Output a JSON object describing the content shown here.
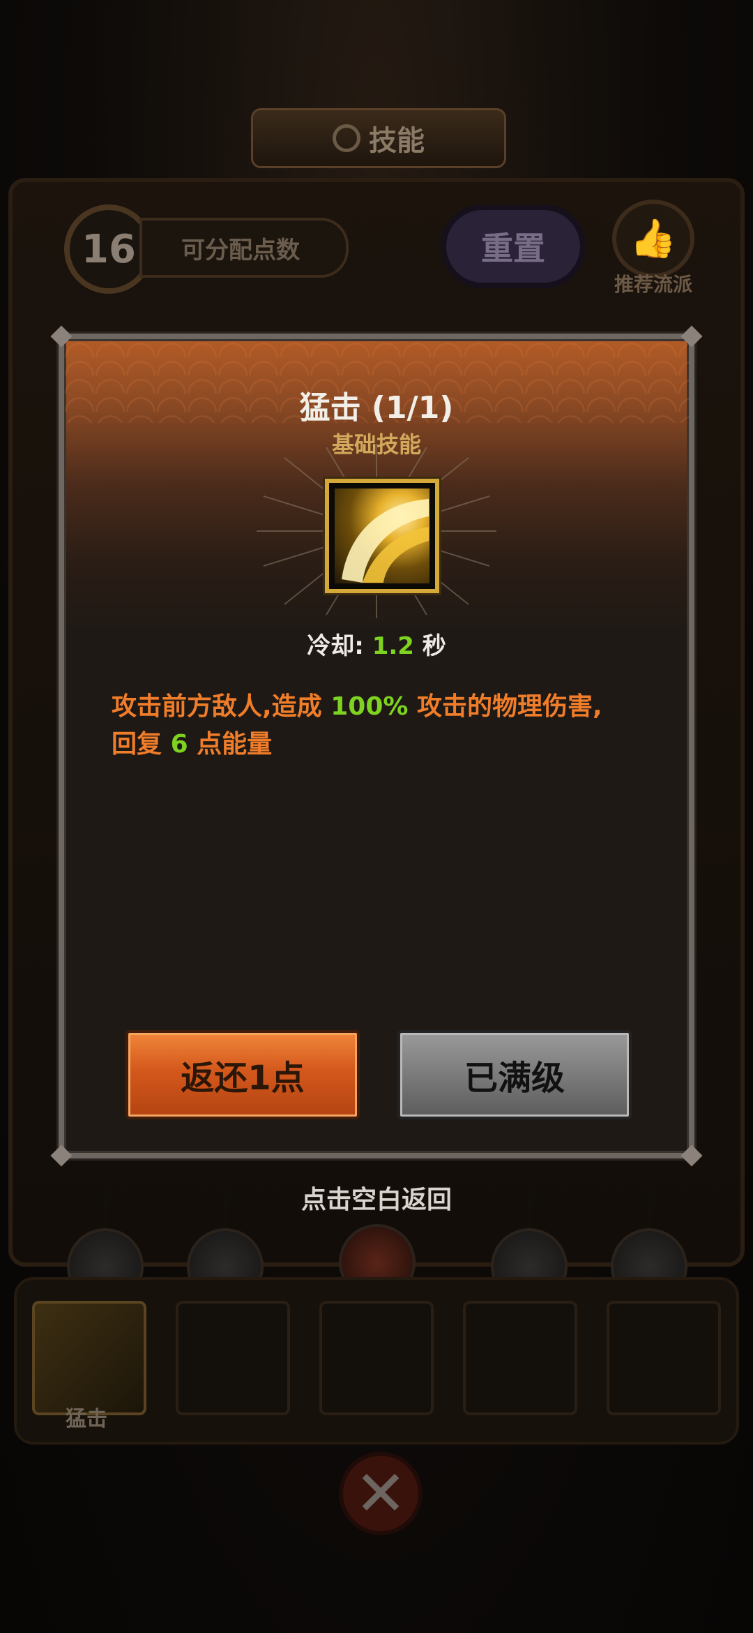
{
  "background": {
    "title": "技能",
    "points_value": "16",
    "points_label": "可分配点数",
    "reset_label": "重置",
    "recommend_label": "推荐流派",
    "slot_skill_name": "猛击"
  },
  "modal": {
    "skill_title": "猛击 (1/1)",
    "skill_category": "基础技能",
    "cooldown_label": "冷却:",
    "cooldown_value": "1.2",
    "cooldown_unit": "秒",
    "description": {
      "part1": "攻击前方敌人,造成",
      "damage_value": "100%",
      "part2": "攻击的物理伤害,",
      "part3": "回复",
      "energy_value": "6",
      "part4": "点能量"
    },
    "return_button": "返还1点",
    "maxed_button": "已满级"
  },
  "hint": "点击空白返回",
  "colors": {
    "accent_orange": "#f07d2a",
    "value_green": "#7ed321",
    "category_gold": "#d2a95c"
  }
}
